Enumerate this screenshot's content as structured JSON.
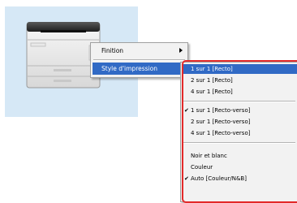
{
  "context_menu": {
    "items": [
      {
        "label": "Finition",
        "has_submenu": true
      },
      {
        "label": "Style d'impression",
        "has_submenu": true,
        "selected": true
      }
    ]
  },
  "submenu": {
    "items": [
      {
        "label": "1 sur 1 [Recto]",
        "selected": true,
        "checked": false
      },
      {
        "label": "2 sur 1 [Recto]",
        "checked": false
      },
      {
        "label": "4 sur 1 [Recto]",
        "checked": false
      },
      {
        "label": "1 sur 1 [Recto-verso]",
        "checked": true
      },
      {
        "label": "2 sur 1 [Recto-verso]",
        "checked": false
      },
      {
        "label": "4 sur 1 [Recto-verso]",
        "checked": false
      },
      {
        "label": "Noir et blanc",
        "checked": false
      },
      {
        "label": "Couleur",
        "checked": false
      },
      {
        "label": "Auto [Couleur/N&B]",
        "checked": true
      }
    ],
    "check_glyph": "✔"
  },
  "colors": {
    "selection": "#316ac5",
    "panel_bg": "#d6e8f6",
    "highlight_border": "#e32a2a"
  },
  "icons": {
    "printer": "printer-icon"
  }
}
